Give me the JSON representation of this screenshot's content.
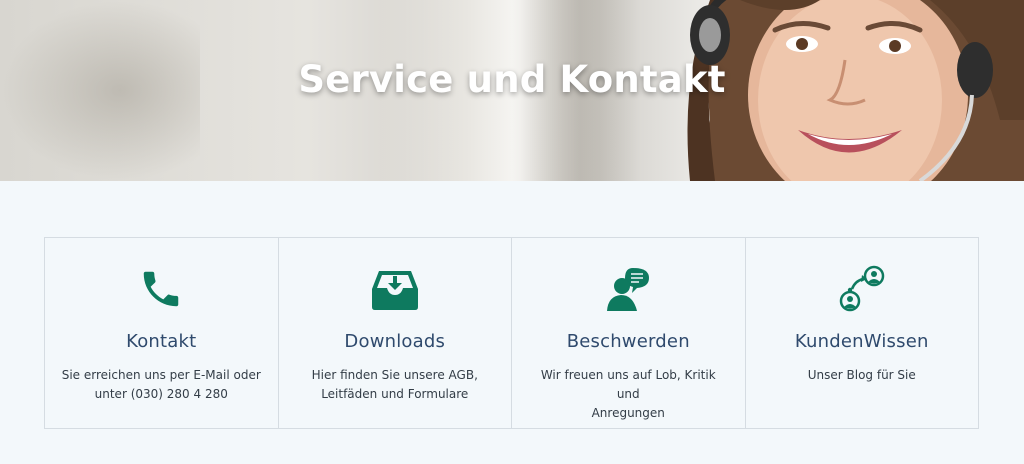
{
  "hero": {
    "title": "Service und Kontakt"
  },
  "colors": {
    "accent": "#0e7a5f",
    "title": "#2f4a6d",
    "text": "#333d47",
    "background": "#f3f8fb",
    "border": "#d5dce2"
  },
  "cards": [
    {
      "icon": "phone-icon",
      "title": "Kontakt",
      "desc_line1": "Sie erreichen uns per E-Mail oder",
      "desc_line2": "unter (030) 280 4 280"
    },
    {
      "icon": "inbox-download-icon",
      "title": "Downloads",
      "desc_line1": "Hier finden Sie unsere AGB,",
      "desc_line2": "Leitfäden und Formulare"
    },
    {
      "icon": "speech-person-icon",
      "title": "Beschwerden",
      "desc_line1": "Wir freuen uns auf Lob, Kritik und",
      "desc_line2": "Anregungen"
    },
    {
      "icon": "user-exchange-icon",
      "title": "KundenWissen",
      "desc_line1": "Unser Blog für Sie",
      "desc_line2": ""
    }
  ]
}
